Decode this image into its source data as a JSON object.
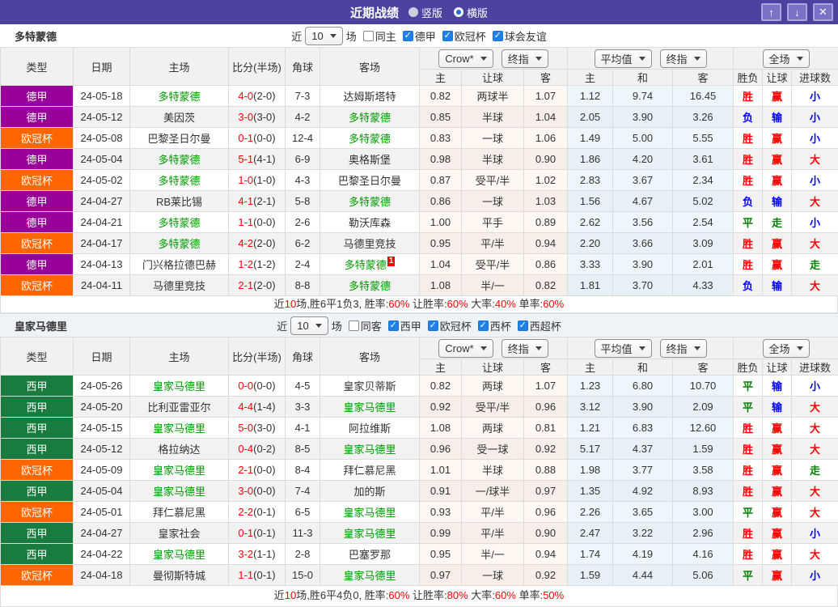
{
  "titlebar": {
    "title": "近期战绩",
    "view_options": [
      {
        "label": "竖版",
        "selected": false
      },
      {
        "label": "横版",
        "selected": true
      }
    ],
    "window_buttons": {
      "up": "↑",
      "down": "↓",
      "close": "✕"
    }
  },
  "table_header": {
    "main_cols": [
      "类型",
      "日期",
      "主场",
      "比分(半场)",
      "角球",
      "客场"
    ],
    "odds_sub": [
      "主",
      "让球",
      "客"
    ],
    "avg_sub": [
      "主",
      "和",
      "客"
    ],
    "result_sub": [
      "胜负",
      "让球",
      "进球数"
    ],
    "bookmaker_select": "Crow*",
    "odds_final_select": "终指",
    "average_select": "平均值",
    "avg_final_select": "终指",
    "scope_select": "全场"
  },
  "filter_common": {
    "prefix": "近",
    "count": "10",
    "suffix": "场"
  },
  "colors": {
    "win_red": "#FF0000",
    "draw_green": "#008000",
    "lose_blue": "#0000FF"
  },
  "sections": [
    {
      "team": "多特蒙德",
      "filter": {
        "same_label": "同主",
        "same_checked": false,
        "competitions": [
          {
            "label": "德甲",
            "checked": true
          },
          {
            "label": "欧冠杯",
            "checked": true
          },
          {
            "label": "球会友谊",
            "checked": true
          }
        ]
      },
      "rows": [
        {
          "league": "德甲",
          "league_color": "#990099",
          "date": "24-05-18",
          "home": "多特蒙德",
          "hg": true,
          "score": "4-0",
          "half": "(2-0)",
          "corners": "7-3",
          "away": "达姆斯塔特",
          "ag": false,
          "o1": "0.82",
          "o2": "两球半",
          "o3": "1.07",
          "a1": "1.12",
          "a2": "9.74",
          "a3": "16.45",
          "r1": [
            "胜",
            "r"
          ],
          "r2": [
            "赢",
            "r"
          ],
          "r3": [
            "小",
            "b"
          ]
        },
        {
          "league": "德甲",
          "league_color": "#990099",
          "date": "24-05-12",
          "home": "美因茨",
          "hg": false,
          "score": "3-0",
          "half": "(3-0)",
          "corners": "4-2",
          "away": "多特蒙德",
          "ag": true,
          "o1": "0.85",
          "o2": "半球",
          "o3": "1.04",
          "a1": "2.05",
          "a2": "3.90",
          "a3": "3.26",
          "r1": [
            "负",
            "b"
          ],
          "r2": [
            "输",
            "b"
          ],
          "r3": [
            "小",
            "b"
          ]
        },
        {
          "league": "欧冠杯",
          "league_color": "#FF6600",
          "date": "24-05-08",
          "home": "巴黎圣日尔曼",
          "hg": false,
          "score": "0-1",
          "half": "(0-0)",
          "corners": "12-4",
          "away": "多特蒙德",
          "ag": true,
          "o1": "0.83",
          "o2": "一球",
          "o3": "1.06",
          "a1": "1.49",
          "a2": "5.00",
          "a3": "5.55",
          "r1": [
            "胜",
            "r"
          ],
          "r2": [
            "赢",
            "r"
          ],
          "r3": [
            "小",
            "b"
          ]
        },
        {
          "league": "德甲",
          "league_color": "#990099",
          "date": "24-05-04",
          "home": "多特蒙德",
          "hg": true,
          "score": "5-1",
          "half": "(4-1)",
          "corners": "6-9",
          "away": "奥格斯堡",
          "ag": false,
          "o1": "0.98",
          "o2": "半球",
          "o3": "0.90",
          "a1": "1.86",
          "a2": "4.20",
          "a3": "3.61",
          "r1": [
            "胜",
            "r"
          ],
          "r2": [
            "赢",
            "r"
          ],
          "r3": [
            "大",
            "r"
          ]
        },
        {
          "league": "欧冠杯",
          "league_color": "#FF6600",
          "date": "24-05-02",
          "home": "多特蒙德",
          "hg": true,
          "score": "1-0",
          "half": "(1-0)",
          "corners": "4-3",
          "away": "巴黎圣日尔曼",
          "ag": false,
          "o1": "0.87",
          "o2": "受平/半",
          "o3": "1.02",
          "a1": "2.83",
          "a2": "3.67",
          "a3": "2.34",
          "r1": [
            "胜",
            "r"
          ],
          "r2": [
            "赢",
            "r"
          ],
          "r3": [
            "小",
            "b"
          ]
        },
        {
          "league": "德甲",
          "league_color": "#990099",
          "date": "24-04-27",
          "home": "RB莱比锡",
          "hg": false,
          "score": "4-1",
          "half": "(2-1)",
          "corners": "5-8",
          "away": "多特蒙德",
          "ag": true,
          "o1": "0.86",
          "o2": "一球",
          "o3": "1.03",
          "a1": "1.56",
          "a2": "4.67",
          "a3": "5.02",
          "r1": [
            "负",
            "b"
          ],
          "r2": [
            "输",
            "b"
          ],
          "r3": [
            "大",
            "r"
          ]
        },
        {
          "league": "德甲",
          "league_color": "#990099",
          "date": "24-04-21",
          "home": "多特蒙德",
          "hg": true,
          "score": "1-1",
          "half": "(0-0)",
          "corners": "2-6",
          "away": "勒沃库森",
          "ag": false,
          "o1": "1.00",
          "o2": "平手",
          "o3": "0.89",
          "a1": "2.62",
          "a2": "3.56",
          "a3": "2.54",
          "r1": [
            "平",
            "g"
          ],
          "r2": [
            "走",
            "g"
          ],
          "r3": [
            "小",
            "b"
          ]
        },
        {
          "league": "欧冠杯",
          "league_color": "#FF6600",
          "date": "24-04-17",
          "home": "多特蒙德",
          "hg": true,
          "score": "4-2",
          "half": "(2-0)",
          "corners": "6-2",
          "away": "马德里竞技",
          "ag": false,
          "o1": "0.95",
          "o2": "平/半",
          "o3": "0.94",
          "a1": "2.20",
          "a2": "3.66",
          "a3": "3.09",
          "r1": [
            "胜",
            "r"
          ],
          "r2": [
            "赢",
            "r"
          ],
          "r3": [
            "大",
            "r"
          ]
        },
        {
          "league": "德甲",
          "league_color": "#990099",
          "date": "24-04-13",
          "home": "门兴格拉德巴赫",
          "hg": false,
          "score": "1-2",
          "half": "(1-2)",
          "corners": "2-4",
          "away": "多特蒙德",
          "ag": true,
          "away_badge": "1",
          "o1": "1.04",
          "o2": "受平/半",
          "o3": "0.86",
          "a1": "3.33",
          "a2": "3.90",
          "a3": "2.01",
          "r1": [
            "胜",
            "r"
          ],
          "r2": [
            "赢",
            "r"
          ],
          "r3": [
            "走",
            "g"
          ]
        },
        {
          "league": "欧冠杯",
          "league_color": "#FF6600",
          "date": "24-04-11",
          "home": "马德里竞技",
          "hg": false,
          "score": "2-1",
          "half": "(2-0)",
          "corners": "8-8",
          "away": "多特蒙德",
          "ag": true,
          "o1": "1.08",
          "o2": "半/一",
          "o3": "0.82",
          "a1": "1.81",
          "a2": "3.70",
          "a3": "4.33",
          "r1": [
            "负",
            "b"
          ],
          "r2": [
            "输",
            "b"
          ],
          "r3": [
            "大",
            "r"
          ]
        }
      ],
      "summary": [
        [
          "近",
          "d"
        ],
        [
          "10",
          "r"
        ],
        [
          "场,胜6平1负3, 胜率:",
          "d"
        ],
        [
          "60%",
          "r"
        ],
        [
          " 让胜率:",
          "d"
        ],
        [
          "60%",
          "r"
        ],
        [
          " 大率:",
          "d"
        ],
        [
          "40%",
          "r"
        ],
        [
          " 单率:",
          "d"
        ],
        [
          "60%",
          "r"
        ]
      ]
    },
    {
      "team": "皇家马德里",
      "filter": {
        "same_label": "同客",
        "same_checked": false,
        "competitions": [
          {
            "label": "西甲",
            "checked": true
          },
          {
            "label": "欧冠杯",
            "checked": true
          },
          {
            "label": "西杯",
            "checked": true
          },
          {
            "label": "西超杯",
            "checked": true
          }
        ]
      },
      "rows": [
        {
          "league": "西甲",
          "league_color": "#177C3D",
          "date": "24-05-26",
          "home": "皇家马德里",
          "hg": true,
          "score": "0-0",
          "half": "(0-0)",
          "corners": "4-5",
          "away": "皇家贝蒂斯",
          "ag": false,
          "o1": "0.82",
          "o2": "两球",
          "o3": "1.07",
          "a1": "1.23",
          "a2": "6.80",
          "a3": "10.70",
          "r1": [
            "平",
            "g"
          ],
          "r2": [
            "输",
            "b"
          ],
          "r3": [
            "小",
            "b"
          ]
        },
        {
          "league": "西甲",
          "league_color": "#177C3D",
          "date": "24-05-20",
          "home": "比利亚雷亚尔",
          "hg": false,
          "score": "4-4",
          "half": "(1-4)",
          "corners": "3-3",
          "away": "皇家马德里",
          "ag": true,
          "o1": "0.92",
          "o2": "受平/半",
          "o3": "0.96",
          "a1": "3.12",
          "a2": "3.90",
          "a3": "2.09",
          "r1": [
            "平",
            "g"
          ],
          "r2": [
            "输",
            "b"
          ],
          "r3": [
            "大",
            "r"
          ]
        },
        {
          "league": "西甲",
          "league_color": "#177C3D",
          "date": "24-05-15",
          "home": "皇家马德里",
          "hg": true,
          "score": "5-0",
          "half": "(3-0)",
          "corners": "4-1",
          "away": "阿拉维斯",
          "ag": false,
          "o1": "1.08",
          "o2": "两球",
          "o3": "0.81",
          "a1": "1.21",
          "a2": "6.83",
          "a3": "12.60",
          "r1": [
            "胜",
            "r"
          ],
          "r2": [
            "赢",
            "r"
          ],
          "r3": [
            "大",
            "r"
          ]
        },
        {
          "league": "西甲",
          "league_color": "#177C3D",
          "date": "24-05-12",
          "home": "格拉纳达",
          "hg": false,
          "score": "0-4",
          "half": "(0-2)",
          "corners": "8-5",
          "away": "皇家马德里",
          "ag": true,
          "o1": "0.96",
          "o2": "受一球",
          "o3": "0.92",
          "a1": "5.17",
          "a2": "4.37",
          "a3": "1.59",
          "r1": [
            "胜",
            "r"
          ],
          "r2": [
            "赢",
            "r"
          ],
          "r3": [
            "大",
            "r"
          ]
        },
        {
          "league": "欧冠杯",
          "league_color": "#FF6600",
          "date": "24-05-09",
          "home": "皇家马德里",
          "hg": true,
          "score": "2-1",
          "half": "(0-0)",
          "corners": "8-4",
          "away": "拜仁慕尼黑",
          "ag": false,
          "o1": "1.01",
          "o2": "半球",
          "o3": "0.88",
          "a1": "1.98",
          "a2": "3.77",
          "a3": "3.58",
          "r1": [
            "胜",
            "r"
          ],
          "r2": [
            "赢",
            "r"
          ],
          "r3": [
            "走",
            "g"
          ]
        },
        {
          "league": "西甲",
          "league_color": "#177C3D",
          "date": "24-05-04",
          "home": "皇家马德里",
          "hg": true,
          "score": "3-0",
          "half": "(0-0)",
          "corners": "7-4",
          "away": "加的斯",
          "ag": false,
          "o1": "0.91",
          "o2": "一/球半",
          "o3": "0.97",
          "a1": "1.35",
          "a2": "4.92",
          "a3": "8.93",
          "r1": [
            "胜",
            "r"
          ],
          "r2": [
            "赢",
            "r"
          ],
          "r3": [
            "大",
            "r"
          ]
        },
        {
          "league": "欧冠杯",
          "league_color": "#FF6600",
          "date": "24-05-01",
          "home": "拜仁慕尼黑",
          "hg": false,
          "score": "2-2",
          "half": "(0-1)",
          "corners": "6-5",
          "away": "皇家马德里",
          "ag": true,
          "o1": "0.93",
          "o2": "平/半",
          "o3": "0.96",
          "a1": "2.26",
          "a2": "3.65",
          "a3": "3.00",
          "r1": [
            "平",
            "g"
          ],
          "r2": [
            "赢",
            "r"
          ],
          "r3": [
            "大",
            "r"
          ]
        },
        {
          "league": "西甲",
          "league_color": "#177C3D",
          "date": "24-04-27",
          "home": "皇家社会",
          "hg": false,
          "score": "0-1",
          "half": "(0-1)",
          "corners": "11-3",
          "away": "皇家马德里",
          "ag": true,
          "o1": "0.99",
          "o2": "平/半",
          "o3": "0.90",
          "a1": "2.47",
          "a2": "3.22",
          "a3": "2.96",
          "r1": [
            "胜",
            "r"
          ],
          "r2": [
            "赢",
            "r"
          ],
          "r3": [
            "小",
            "b"
          ]
        },
        {
          "league": "西甲",
          "league_color": "#177C3D",
          "date": "24-04-22",
          "home": "皇家马德里",
          "hg": true,
          "score": "3-2",
          "half": "(1-1)",
          "corners": "2-8",
          "away": "巴塞罗那",
          "ag": false,
          "o1": "0.95",
          "o2": "半/一",
          "o3": "0.94",
          "a1": "1.74",
          "a2": "4.19",
          "a3": "4.16",
          "r1": [
            "胜",
            "r"
          ],
          "r2": [
            "赢",
            "r"
          ],
          "r3": [
            "大",
            "r"
          ]
        },
        {
          "league": "欧冠杯",
          "league_color": "#FF6600",
          "date": "24-04-18",
          "home": "曼彻斯特城",
          "hg": false,
          "score": "1-1",
          "half": "(0-1)",
          "corners": "15-0",
          "away": "皇家马德里",
          "ag": true,
          "o1": "0.97",
          "o2": "一球",
          "o3": "0.92",
          "a1": "1.59",
          "a2": "4.44",
          "a3": "5.06",
          "r1": [
            "平",
            "g"
          ],
          "r2": [
            "赢",
            "r"
          ],
          "r3": [
            "小",
            "b"
          ]
        }
      ],
      "summary": [
        [
          "近",
          "d"
        ],
        [
          "10",
          "r"
        ],
        [
          "场,胜6平4负0, 胜率:",
          "d"
        ],
        [
          "60%",
          "r"
        ],
        [
          " 让胜率:",
          "d"
        ],
        [
          "80%",
          "r"
        ],
        [
          " 大率:",
          "d"
        ],
        [
          "60%",
          "r"
        ],
        [
          " 单率:",
          "d"
        ],
        [
          "50%",
          "r"
        ]
      ]
    }
  ]
}
